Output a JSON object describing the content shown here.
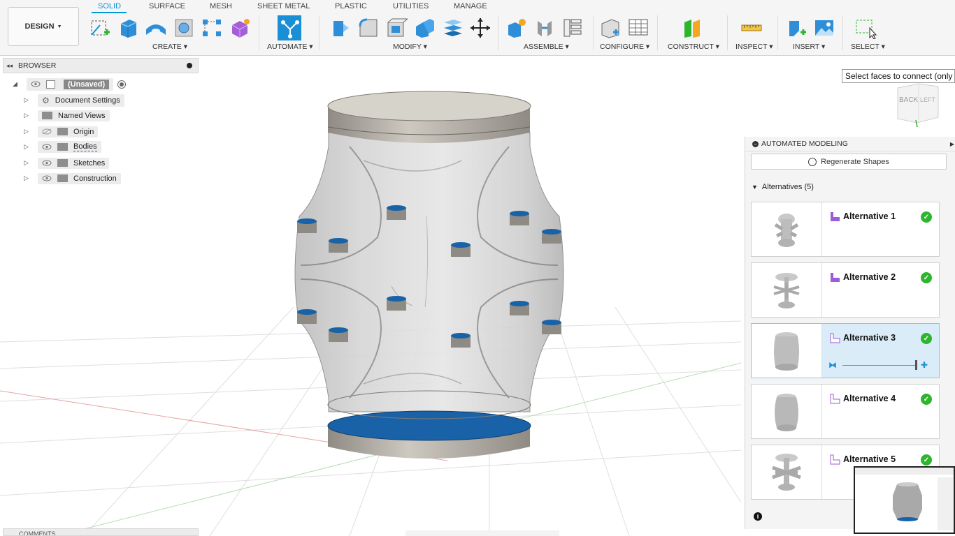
{
  "workspace": {
    "label": "DESIGN"
  },
  "tabs": [
    {
      "label": "SOLID",
      "active": true
    },
    {
      "label": "SURFACE"
    },
    {
      "label": "MESH"
    },
    {
      "label": "SHEET METAL"
    },
    {
      "label": "PLASTIC"
    },
    {
      "label": "UTILITIES"
    },
    {
      "label": "MANAGE"
    }
  ],
  "groups": {
    "create": "CREATE",
    "automate": "AUTOMATE",
    "modify": "MODIFY",
    "assemble": "ASSEMBLE",
    "configure": "CONFIGURE",
    "construct": "CONSTRUCT",
    "inspect": "INSPECT",
    "insert": "INSERT",
    "select": "SELECT"
  },
  "browser": {
    "title": "BROWSER",
    "root": "(Unsaved)",
    "items": [
      {
        "label": "Document Settings",
        "icon": "gear-icon"
      },
      {
        "label": "Named Views",
        "icon": "folder-icon"
      },
      {
        "label": "Origin",
        "icon": "folder-icon",
        "hidden": true
      },
      {
        "label": "Bodies",
        "icon": "folder-icon"
      },
      {
        "label": "Sketches",
        "icon": "folder-icon"
      },
      {
        "label": "Construction",
        "icon": "folder-icon"
      }
    ]
  },
  "tooltip": "Select faces to connect (only",
  "viewcube": {
    "back": "BACK",
    "left": "LEFT"
  },
  "automated_modeling": {
    "title": "AUTOMATED MODELING",
    "regenerate": "Regenerate Shapes",
    "alternatives_title": "Alternatives (5)",
    "alternatives": [
      {
        "label": "Alternative 1",
        "selected": false
      },
      {
        "label": "Alternative 2",
        "selected": false
      },
      {
        "label": "Alternative 3",
        "selected": true,
        "slider_level": 0.98
      },
      {
        "label": "Alternative 4",
        "selected": false
      },
      {
        "label": "Alternative 5",
        "selected": false
      }
    ]
  },
  "comments": {
    "label": "COMMENTS"
  },
  "colors": {
    "accent": "#0696d7",
    "selection_blue": "#1a62a8",
    "check_green": "#2db52d",
    "flag_purple": "#9b5cd6"
  }
}
